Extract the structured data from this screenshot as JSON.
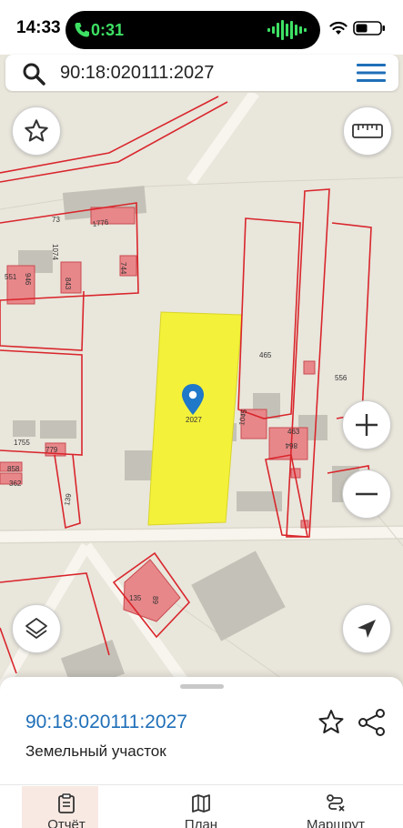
{
  "status_bar": {
    "time": "14:33",
    "call_duration": "0:31",
    "icons": [
      "call-icon",
      "waveform-icon",
      "wifi-icon",
      "battery-icon"
    ]
  },
  "search": {
    "query": "90:18:020111:2027",
    "icon": "search-icon",
    "menu_icon": "hamburger-menu-icon"
  },
  "map": {
    "selected_parcel_label": "2027",
    "parcel_labels": [
      "73",
      "1776",
      "1074",
      "551",
      "946",
      "843",
      "744",
      "465",
      "556",
      "1045",
      "463",
      "864",
      "1755",
      "779",
      "858",
      "362",
      "139",
      "135",
      "89"
    ],
    "highlight_color": "#f4f13a",
    "boundary_color": "#d9262c",
    "building_color": "#e8878a",
    "marker_color": "#1f78c8"
  },
  "controls": {
    "favorite": "star-icon",
    "ruler": "ruler-icon",
    "zoom_in": "+",
    "zoom_out": "−",
    "layers": "layers-icon",
    "locate": "navigation-arrow-icon"
  },
  "sheet": {
    "cadastral_number": "90:18:020111:2027",
    "object_type": "Земельный участок"
  },
  "tabs": [
    {
      "label": "Отчёт",
      "icon": "report-icon"
    },
    {
      "label": "План",
      "icon": "map-plan-icon"
    },
    {
      "label": "Маршрут",
      "icon": "route-icon"
    }
  ]
}
